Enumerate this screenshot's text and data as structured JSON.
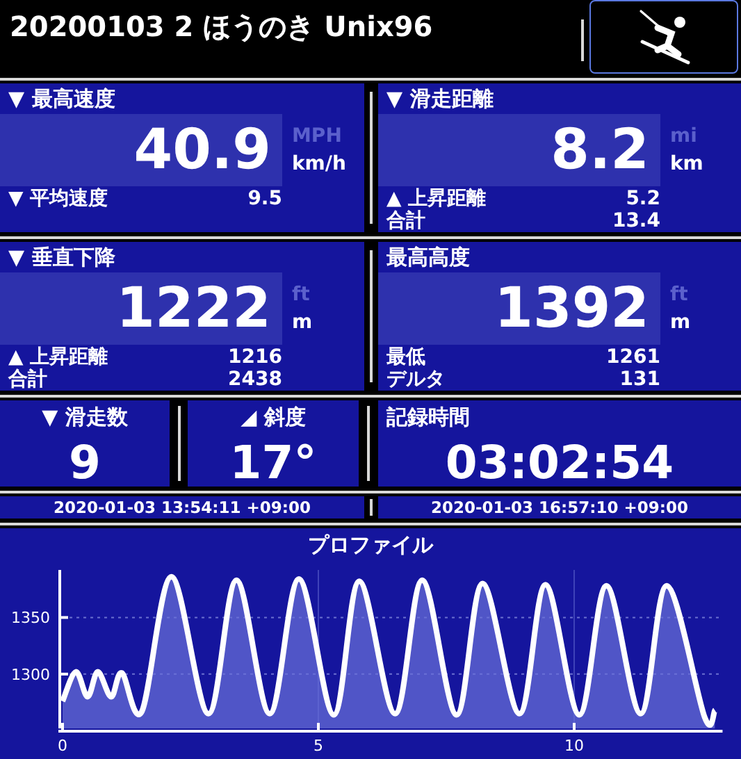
{
  "header": {
    "title": "20200103 2 ほうのき Unix96"
  },
  "stat_rows": [
    {
      "panels": [
        {
          "label": "▼ 最高速度",
          "value": "40.9",
          "units": [
            {
              "label": "MPH",
              "selected": false
            },
            {
              "label": "km/h",
              "selected": true
            }
          ],
          "details": [
            {
              "label": "▼ 平均速度",
              "value": "9.5"
            }
          ]
        },
        {
          "label": "▼ 滑走距離",
          "value": "8.2",
          "units": [
            {
              "label": "mi",
              "selected": false
            },
            {
              "label": "km",
              "selected": true
            }
          ],
          "details": [
            {
              "label": "▲ 上昇距離",
              "value": "5.2"
            },
            {
              "label": "合計",
              "value": "13.4"
            }
          ]
        }
      ]
    },
    {
      "panels": [
        {
          "label": "▼ 垂直下降",
          "value": "1222",
          "units": [
            {
              "label": "ft",
              "selected": false
            },
            {
              "label": "m",
              "selected": true
            }
          ],
          "details": [
            {
              "label": "▲ 上昇距離",
              "value": "1216"
            },
            {
              "label": "合計",
              "value": "2438"
            }
          ]
        },
        {
          "label": "最高高度",
          "value": "1392",
          "units": [
            {
              "label": "ft",
              "selected": false
            },
            {
              "label": "m",
              "selected": true
            }
          ],
          "details": [
            {
              "label": "最低",
              "value": "1261"
            },
            {
              "label": "デルタ",
              "value": "131"
            }
          ]
        }
      ]
    }
  ],
  "tiles": [
    {
      "label": "▼ 滑走数",
      "value": "9",
      "kind": "count"
    },
    {
      "label": "◢ 斜度",
      "value": "17°",
      "kind": "angle"
    },
    {
      "label": "記録時間",
      "value": "03:02:54",
      "kind": "duration"
    }
  ],
  "times": [
    "2020-01-03 13:54:11 +09:00",
    "2020-01-03 16:57:10 +09:00"
  ],
  "profile": {
    "chart_data": {
      "type": "area",
      "title": "プロファイル",
      "grid": true,
      "xlim": [
        0,
        12.9
      ],
      "ylim": [
        1252,
        1392
      ],
      "xticks": [
        {
          "value": 0,
          "label": "0"
        },
        {
          "value": 5,
          "label": "5"
        },
        {
          "value": 10,
          "label": "10"
        }
      ],
      "yticks": [
        {
          "value": 1300,
          "label": "1300"
        },
        {
          "value": 1350,
          "label": "1350"
        }
      ],
      "x": [
        0,
        0.26,
        0.49,
        0.69,
        0.95,
        1.16,
        1.55,
        2.13,
        2.85,
        3.4,
        4.05,
        4.62,
        5.3,
        5.8,
        6.5,
        7.03,
        7.7,
        8.21,
        8.93,
        9.44,
        10.1,
        10.63,
        11.3,
        11.81,
        12.55,
        12.75
      ],
      "series": [
        {
          "color": "#ffffff",
          "values": [
            1276,
            1302,
            1280,
            1302,
            1280,
            1301,
            1267,
            1386,
            1265,
            1383,
            1265,
            1384,
            1264,
            1382,
            1265,
            1383,
            1264,
            1380,
            1265,
            1379,
            1264,
            1378,
            1265,
            1378,
            1262,
            1268
          ]
        }
      ]
    }
  }
}
